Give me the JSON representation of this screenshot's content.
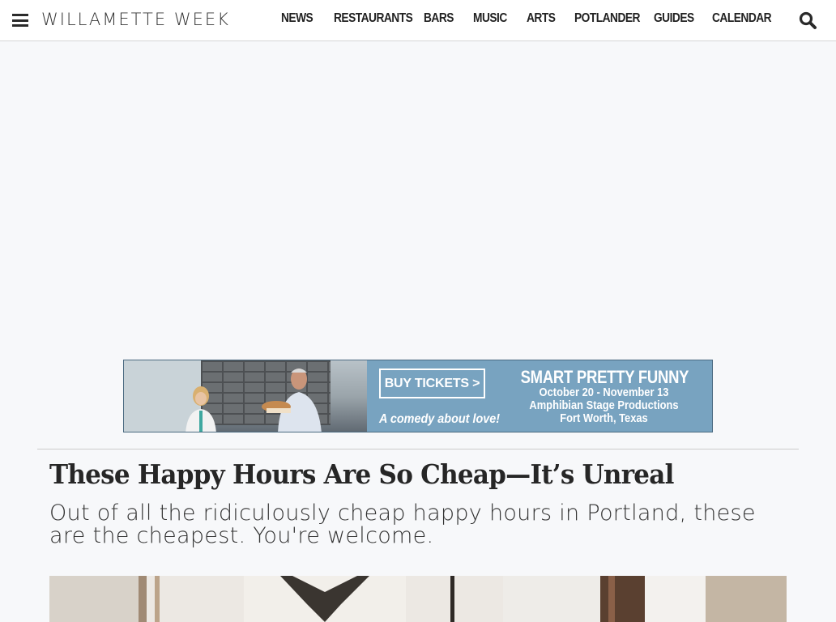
{
  "header": {
    "logo": "WILLAMETTE WEEK",
    "nav": [
      {
        "label": "NEWS"
      },
      {
        "label": "RESTAURANTS"
      },
      {
        "label": "BARS"
      },
      {
        "label": "MUSIC"
      },
      {
        "label": "ARTS"
      },
      {
        "label": "POTLANDER"
      },
      {
        "label": "GUIDES"
      },
      {
        "label": "CALENDAR"
      }
    ],
    "menu_icon": "hamburger-menu-icon",
    "search_icon": "search-icon"
  },
  "banner": {
    "button": "BUY TICKETS >",
    "tagline": "A comedy about love!",
    "title": "SMART PRETTY FUNNY",
    "dates": "October 20 - November 13",
    "producer": "Amphibian Stage Productions",
    "location": "Fort Worth, Texas",
    "bg_color": "#78a3c0"
  },
  "article": {
    "headline": "These Happy Hours Are So Cheap—It’s Unreal",
    "dek": "Out of all the ridiculously cheap happy hours in Portland, these are the cheapest. You're welcome."
  }
}
